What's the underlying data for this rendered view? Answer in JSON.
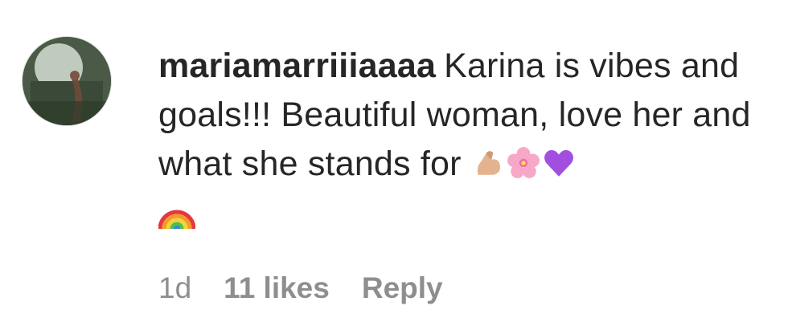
{
  "comment": {
    "username": "mariamarriiiaaaa",
    "text": "Karina is vibes and goals!!! Beautiful woman, love her and what she stands for",
    "emojis": [
      "flexed-biceps",
      "cherry-blossom",
      "purple-heart",
      "rainbow"
    ]
  },
  "meta": {
    "time": "1d",
    "likes": "11 likes",
    "reply": "Reply"
  }
}
